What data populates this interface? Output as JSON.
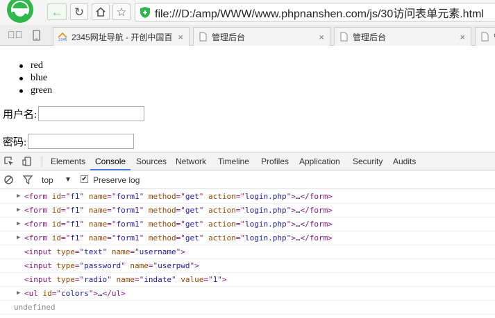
{
  "browser": {
    "url": "file:///D:/amp/WWW/www.phpnanshen.com/js/30访问表单元素.html",
    "tabs": [
      {
        "label": "2345网址导航 - 开创中国百",
        "close": "×"
      },
      {
        "label": "管理后台",
        "close": "×"
      },
      {
        "label": "管理后台",
        "close": "×"
      },
      {
        "label": "管",
        "close": ""
      }
    ]
  },
  "page": {
    "list": [
      "red",
      "blue",
      "green"
    ],
    "username_label": "用户名:",
    "password_label": "密码:"
  },
  "devtools": {
    "tabs": [
      "Elements",
      "Console",
      "Sources",
      "Network",
      "Timeline",
      "Profiles",
      "Application",
      "Security",
      "Audits"
    ],
    "active_tab": "Console",
    "context": "top",
    "preserve_log_label": "Preserve log",
    "preserve_log_checked": true,
    "lines": [
      {
        "expandable": true,
        "parts": [
          "<form ",
          "id",
          "=\"",
          "f1",
          "\" ",
          "name",
          "=\"",
          "form1",
          "\" ",
          "method",
          "=\"",
          "get",
          "\" ",
          "action",
          "=\"",
          "login.php",
          "\">",
          "…",
          "</form>"
        ]
      },
      {
        "expandable": true,
        "parts": [
          "<form ",
          "id",
          "=\"",
          "f1",
          "\" ",
          "name",
          "=\"",
          "form1",
          "\" ",
          "method",
          "=\"",
          "get",
          "\" ",
          "action",
          "=\"",
          "login.php",
          "\">",
          "…",
          "</form>"
        ]
      },
      {
        "expandable": true,
        "parts": [
          "<form ",
          "id",
          "=\"",
          "f1",
          "\" ",
          "name",
          "=\"",
          "form1",
          "\" ",
          "method",
          "=\"",
          "get",
          "\" ",
          "action",
          "=\"",
          "login.php",
          "\">",
          "…",
          "</form>"
        ]
      },
      {
        "expandable": true,
        "parts": [
          "<form ",
          "id",
          "=\"",
          "f1",
          "\" ",
          "name",
          "=\"",
          "form1",
          "\" ",
          "method",
          "=\"",
          "get",
          "\" ",
          "action",
          "=\"",
          "login.php",
          "\">",
          "…",
          "</form>"
        ]
      }
    ],
    "input_lines": [
      "<input type=\"text\" name=\"username\">",
      "<input type=\"password\" name=\"userpwd\">",
      "<input type=\"radio\" name=\"indate\" value=\"1\">"
    ],
    "ul_line": "<ul id=\"colors\">…</ul>",
    "result": "undefined"
  }
}
